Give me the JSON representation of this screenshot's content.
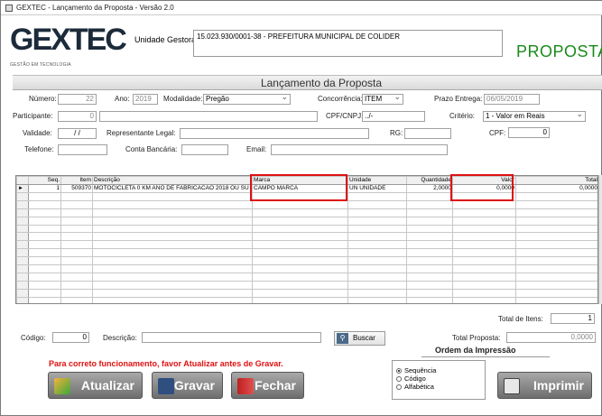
{
  "window": {
    "title": "GEXTEC - Lançamento da Proposta - Versão 2.0"
  },
  "header": {
    "logo_text_1": "GE",
    "logo_text_2": "X",
    "logo_text_3": "TEC",
    "logo_subtitle": "GESTÃO EM TECNOLOGIA",
    "unidade_label": "Unidade Gestora:",
    "unidade_value": "15.023.930/0001-38 - PREFEITURA MUNICIPAL DE COLIDER",
    "proposta_title": "PROPOSTA"
  },
  "section_title": "Lançamento da Proposta",
  "form": {
    "numero_label": "Número:",
    "numero_value": "22",
    "ano_label": "Ano:",
    "ano_value": "2019",
    "modalidade_label": "Modalidade:",
    "modalidade_value": "Pregão",
    "concorrencia_label": "Concorrência:",
    "concorrencia_value": "ITEM",
    "prazo_label": "Prazo Entrega:",
    "prazo_value": "06/05/2019",
    "participante_label": "Participante:",
    "participante_value": "0",
    "cpfcnpj_label": "CPF/CNPJ:",
    "cpfcnpj_value": "../-",
    "criterio_label": "Critério:",
    "criterio_value": "1 - Valor em Reais",
    "validade_label": "Validade:",
    "validade_value": "/ /",
    "representante_label": "Representante Legal:",
    "rg_label": "RG:",
    "cpf_label": "CPF:",
    "cpf_value": "0",
    "telefone_label": "Telefone:",
    "conta_label": "Conta Bancária:",
    "email_label": "Email:"
  },
  "grid": {
    "columns": [
      "Seq.",
      "Item",
      "Descrição",
      "Marca",
      "Unidade",
      "Quantidade",
      "Valor",
      "Total"
    ],
    "rows": [
      {
        "indicator": "►",
        "seq": "1",
        "item": "509370",
        "descricao": "MOTOCICLETA 0 KM   ANO DE FABRICACAO 2018 OU SU",
        "marca": "CAMPO MARCA",
        "unidade": "UN   UNIDADE",
        "quantidade": "2,0000",
        "valor": "0,0000",
        "total": "0,0000"
      }
    ],
    "empty_rows": 14
  },
  "footer": {
    "total_itens_label": "Total de Itens:",
    "total_itens_value": "1",
    "codigo_label": "Código:",
    "codigo_value": "0",
    "descricao_label": "Descrição:",
    "buscar_label": "Buscar",
    "total_proposta_label": "Total Proposta:",
    "total_proposta_value": "0,0000",
    "ordem_title": "Ordem da Impressão",
    "ordem_options": [
      "Sequência",
      "Código",
      "Alfabética"
    ],
    "warning": "Para correto funcionamento, favor Atualizar antes de Gravar.",
    "btn_atualizar": "Atualizar",
    "btn_gravar": "Gravar",
    "btn_fechar": "Fechar",
    "btn_imprimir": "Imprimir"
  },
  "colors": {
    "accent_green": "#1a8a1a",
    "highlight_red": "#d11111",
    "warning_red": "#e01010"
  }
}
